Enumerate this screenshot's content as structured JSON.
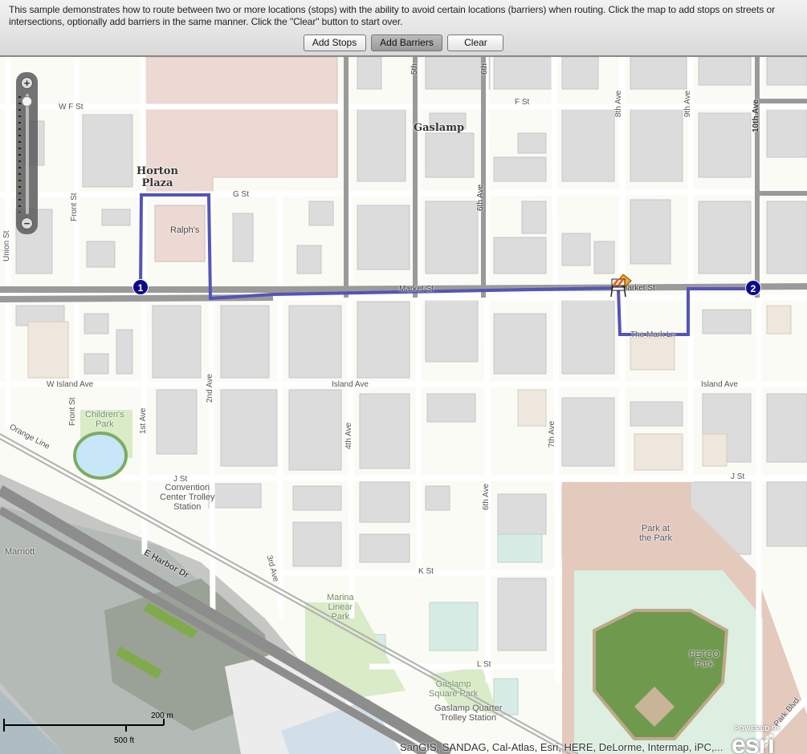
{
  "header": {
    "description": "This sample demonstrates how to route between two or more locations (stops) with the ability to avoid certain locations (barriers) when routing. Click the map to add stops on streets or intersections, optionally add barriers in the same manner. Click the \"Clear\" button to start over.",
    "buttons": {
      "add_stops": "Add Stops",
      "add_barriers": "Add Barriers",
      "clear": "Clear"
    },
    "active_button": "add_barriers"
  },
  "map": {
    "zoom_slider": {
      "zoom_in": "+",
      "zoom_out": "−",
      "level_fraction": 0.06
    },
    "stops": [
      {
        "label": "1"
      },
      {
        "label": "2"
      }
    ],
    "barriers": [
      {
        "icon": "road-barrier-icon"
      }
    ],
    "route_color": "#5454b8",
    "stop_color": "#0c0c8a",
    "street_labels": {
      "w_f_st": "W F St",
      "f_st": "F St",
      "g_st": "G St",
      "market_st_1": "Market St",
      "market_st_2": "Market St",
      "the_mark_ln": "The Mark Ln",
      "w_island_ave": "W Island Ave",
      "island_ave_1": "Island Ave",
      "island_ave_2": "Island Ave",
      "j_st_1": "J St",
      "j_st_2": "J St",
      "k_st": "K St",
      "l_st": "L St",
      "union_st": "Union St",
      "front_st_1": "Front St",
      "front_st_2": "Front St",
      "first_ave": "1st Ave",
      "second_ave": "2nd Ave",
      "third_ave": "3rd Ave",
      "fourth_ave": "4th Ave",
      "fifth": "5th",
      "sixth": "6th",
      "sixth_ave_1": "6th Ave",
      "sixth_ave_2": "6th Ave",
      "seventh_ave": "7th Ave",
      "eighth_ave": "8th Ave",
      "ninth_ave": "9th Ave",
      "tenth_ave": "10th Ave",
      "e_harbor_dr": "E Harbor Dr",
      "orange_line": "Orange Line",
      "park_blvd": "Park Blvd"
    },
    "place_labels": {
      "horton_plaza": "Horton\nPlaza",
      "gaslamp": "Gaslamp",
      "ralphs": "Ralph's",
      "childrens_park": "Children's\nPark",
      "convention_center_trolley": "Convention\nCenter Trolley\nStation",
      "marriott": "Marriott",
      "marina_linear_park": "Marina\nLinear\nPark",
      "park_at_the_park": "Park at\nthe Park",
      "petco_park": "PETCO\nPark",
      "gaslamp_square_park": "Gaslamp\nSquare Park",
      "gaslamp_quarter_trolley": "Gaslamp Quarter\nTrolley Station"
    },
    "scale_bar": {
      "metric": "200 m",
      "imperial": "500 ft"
    },
    "attribution": "SanGIS, SANDAG, Cal-Atlas, Esri, HERE, DeLorme, Intermap, iPC,...",
    "logo": {
      "powered_by": "POWERED BY",
      "brand": "esri"
    }
  }
}
